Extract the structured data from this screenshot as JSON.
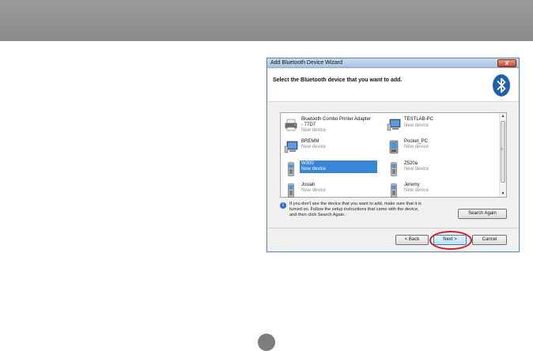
{
  "dialog": {
    "title": "Add Bluetooth Device Wizard",
    "close_label": "x",
    "header": "Select the Bluetooth device that you want to add."
  },
  "devices": [
    {
      "name_line1": "Bluetooth Combo Printer Adapter",
      "name_line2": "- 77D7",
      "status": "New device",
      "icon": "printer-icon"
    },
    {
      "name_line1": "TESTLAB-PC",
      "name_line2": "",
      "status": "New device",
      "icon": "computer-icon"
    },
    {
      "name_line1": "BREMM",
      "name_line2": "",
      "status": "New device",
      "icon": "computer-icon"
    },
    {
      "name_line1": "Pocket_PC",
      "name_line2": "",
      "status": "New device",
      "icon": "pda-icon"
    },
    {
      "name_line1": "W300",
      "name_line2": "",
      "status": "New device",
      "icon": "phone-icon",
      "selected": true
    },
    {
      "name_line1": "Z520a",
      "name_line2": "",
      "status": "New device",
      "icon": "phone-icon"
    },
    {
      "name_line1": "Josiah",
      "name_line2": "",
      "status": "New device",
      "icon": "phone-icon"
    },
    {
      "name_line1": "Jeremy",
      "name_line2": "",
      "status": "New device",
      "icon": "phone-icon"
    }
  ],
  "info": {
    "line1": "If you don't see the device that you want to add, make sure that it is",
    "line2": "turned on. Follow the setup instructions that came with the device,",
    "line3": "and then click Search Again."
  },
  "buttons": {
    "search_again": "Search Again",
    "back": "< Back",
    "next": "Next >",
    "cancel": "Cancel"
  },
  "colors": {
    "selection": "#3a86d6",
    "highlight_ring": "#d0202a",
    "top_band": "#8f8f8f"
  }
}
